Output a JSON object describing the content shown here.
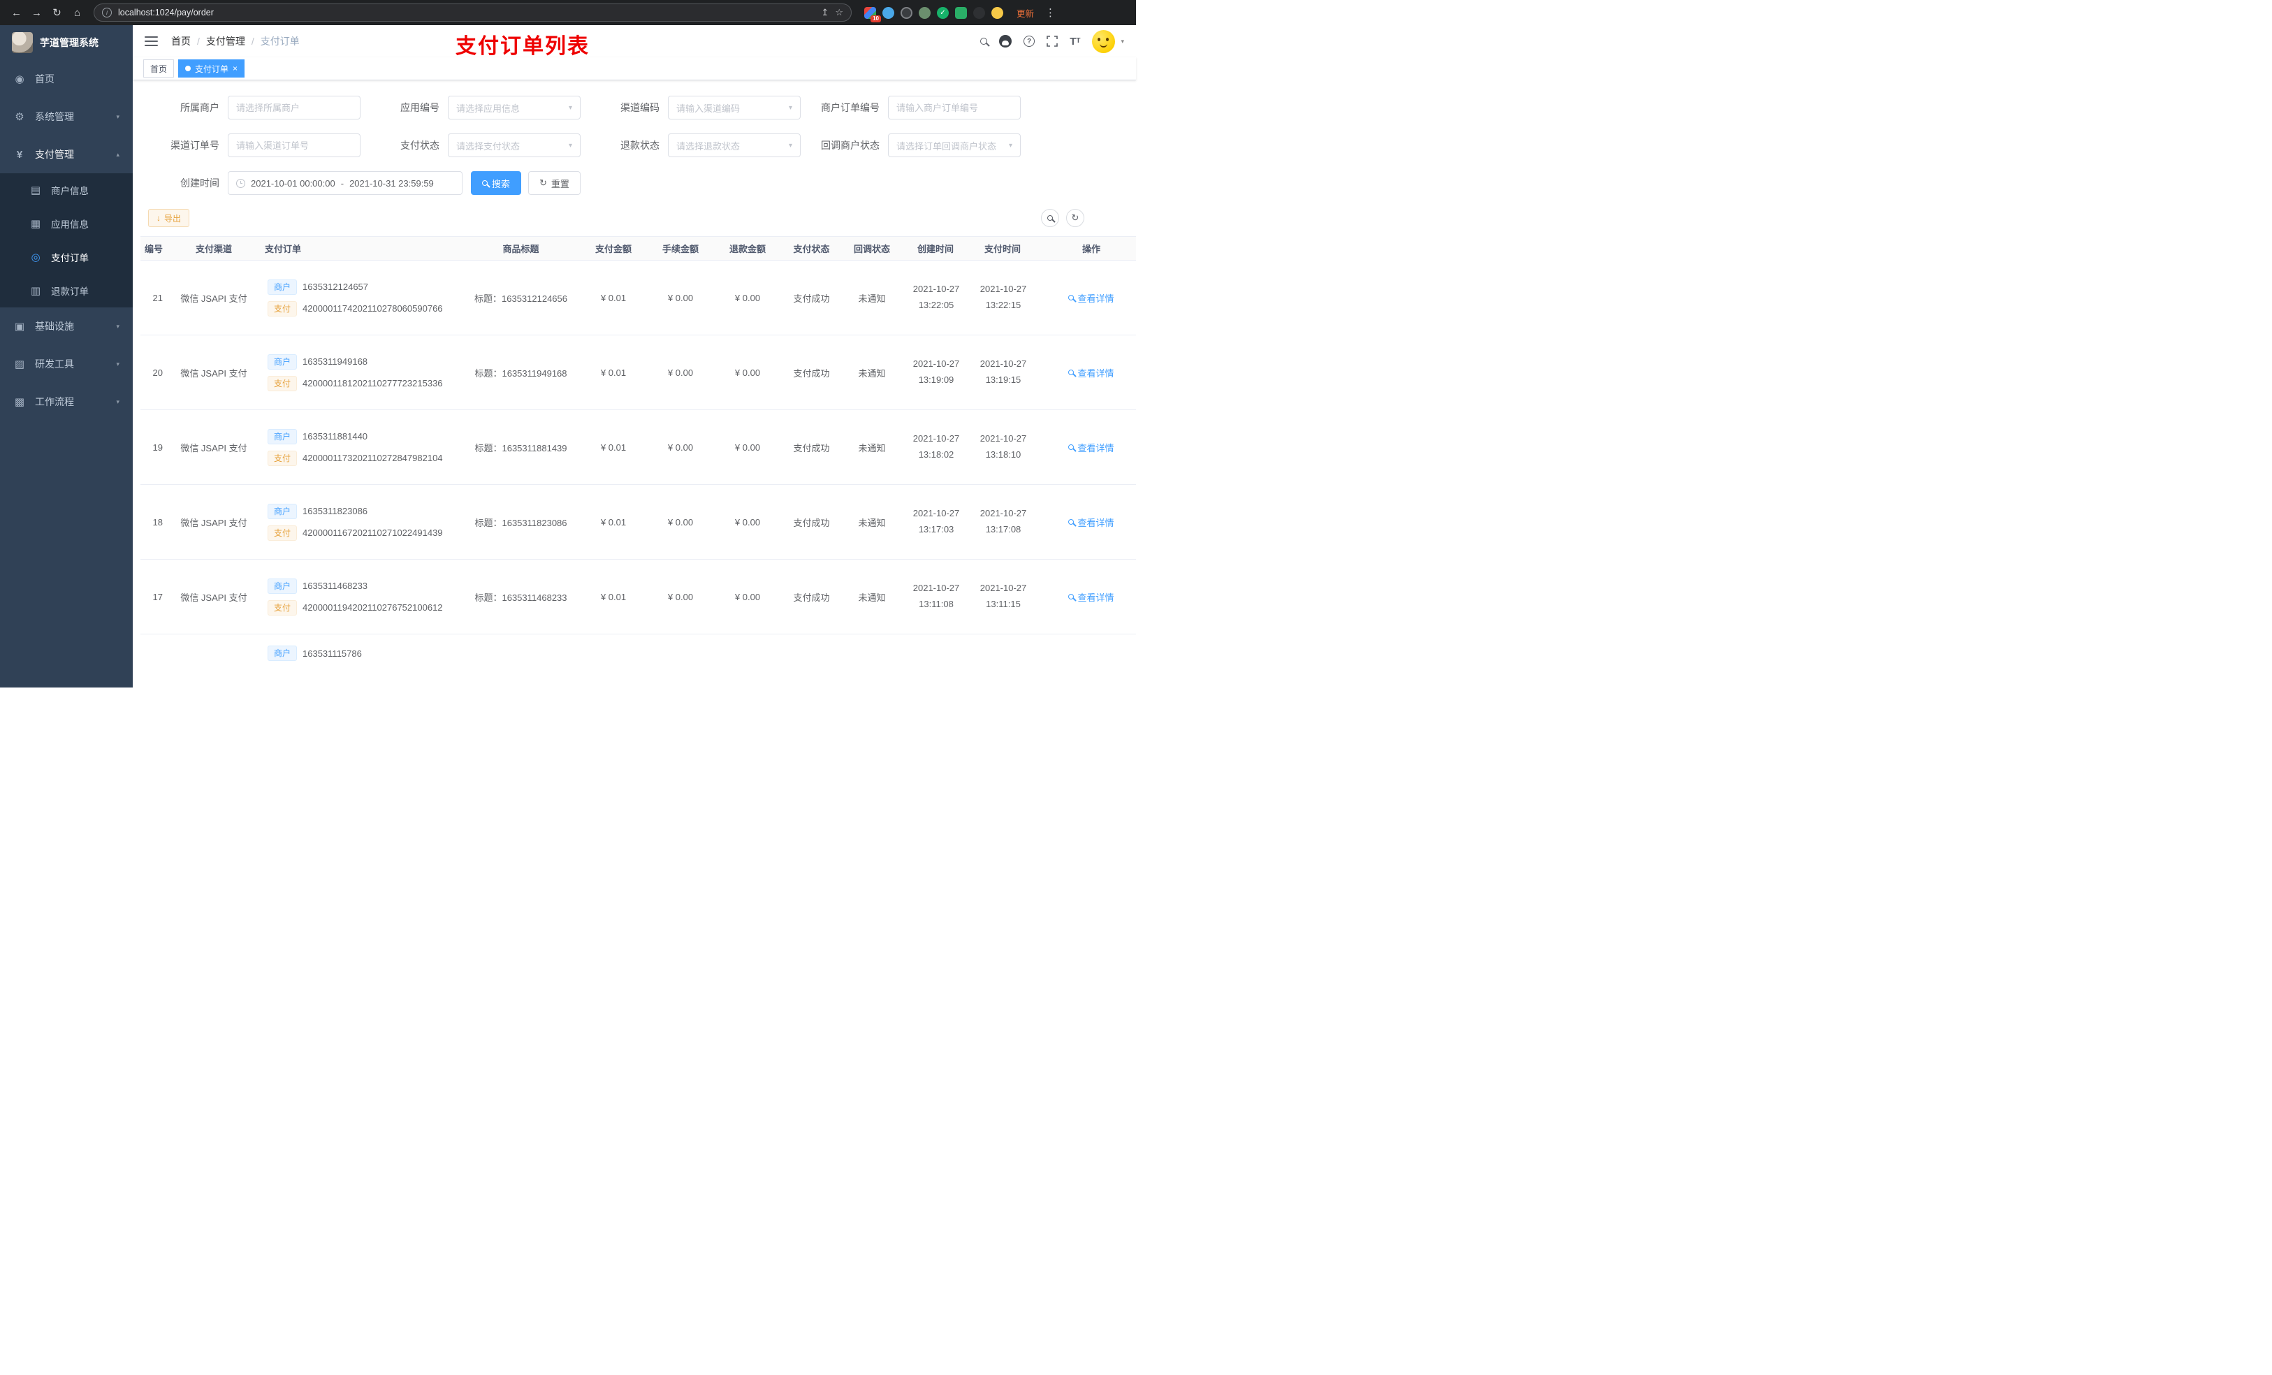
{
  "colors": {
    "accent": "#409eff",
    "warning": "#e6a23c",
    "annotation_red": "#ee0000",
    "sidebar_bg": "#304156"
  },
  "browser": {
    "url": "localhost:1024/pay/order",
    "extension_badge": "10",
    "update_label": "更新"
  },
  "sidebar": {
    "title": "芋道管理系统",
    "items": [
      {
        "label": "首页"
      },
      {
        "label": "系统管理"
      },
      {
        "label": "支付管理"
      },
      {
        "label": "商户信息"
      },
      {
        "label": "应用信息"
      },
      {
        "label": "支付订单"
      },
      {
        "label": "退款订单"
      },
      {
        "label": "基础设施"
      },
      {
        "label": "研发工具"
      },
      {
        "label": "工作流程"
      }
    ]
  },
  "header": {
    "breadcrumb": [
      "首页",
      "支付管理",
      "支付订单"
    ],
    "annotation": "支付订单列表"
  },
  "tabs": {
    "home": "首页",
    "active": "支付订单"
  },
  "filter": {
    "merchant_label": "所属商户",
    "merchant_placeholder": "请选择所属商户",
    "app_label": "应用编号",
    "app_placeholder": "请选择应用信息",
    "channel_code_label": "渠道编码",
    "channel_code_placeholder": "请输入渠道编码",
    "merchant_order_label": "商户订单编号",
    "merchant_order_placeholder": "请输入商户订单编号",
    "channel_order_label": "渠道订单号",
    "channel_order_placeholder": "请输入渠道订单号",
    "pay_status_label": "支付状态",
    "pay_status_placeholder": "请选择支付状态",
    "refund_status_label": "退款状态",
    "refund_status_placeholder": "请选择退款状态",
    "callback_status_label": "回调商户状态",
    "callback_status_placeholder": "请选择订单回调商户状态",
    "create_time_label": "创建时间",
    "date_start": "2021-10-01 00:00:00",
    "date_separator": "-",
    "date_end": "2021-10-31 23:59:59",
    "search_label": "搜索",
    "reset_label": "重置"
  },
  "toolbar": {
    "export_label": "导出"
  },
  "table": {
    "headers": [
      "编号",
      "支付渠道",
      "支付订单",
      "商品标题",
      "支付金额",
      "手续金额",
      "退款金额",
      "支付状态",
      "回调状态",
      "创建时间",
      "支付时间",
      "操作"
    ],
    "merchant_tag": "商户",
    "pay_tag": "支付",
    "detail_label": "查看详情",
    "rows": [
      {
        "id": "21",
        "channel": "微信 JSAPI 支付",
        "merchant_no": "1635312124657",
        "pay_no": "4200001174202110278060590766",
        "title": "标题：1635312124656",
        "amount": "¥ 0.01",
        "fee": "¥ 0.00",
        "refund": "¥ 0.00",
        "status": "支付成功",
        "notify": "未通知",
        "created": "2021-10-27 13:22:05",
        "paid": "2021-10-27 13:22:15"
      },
      {
        "id": "20",
        "channel": "微信 JSAPI 支付",
        "merchant_no": "1635311949168",
        "pay_no": "4200001181202110277723215336",
        "title": "标题：1635311949168",
        "amount": "¥ 0.01",
        "fee": "¥ 0.00",
        "refund": "¥ 0.00",
        "status": "支付成功",
        "notify": "未通知",
        "created": "2021-10-27 13:19:09",
        "paid": "2021-10-27 13:19:15"
      },
      {
        "id": "19",
        "channel": "微信 JSAPI 支付",
        "merchant_no": "1635311881440",
        "pay_no": "4200001173202110272847982104",
        "title": "标题：1635311881439",
        "amount": "¥ 0.01",
        "fee": "¥ 0.00",
        "refund": "¥ 0.00",
        "status": "支付成功",
        "notify": "未通知",
        "created": "2021-10-27 13:18:02",
        "paid": "2021-10-27 13:18:10"
      },
      {
        "id": "18",
        "channel": "微信 JSAPI 支付",
        "merchant_no": "1635311823086",
        "pay_no": "4200001167202110271022491439",
        "title": "标题：1635311823086",
        "amount": "¥ 0.01",
        "fee": "¥ 0.00",
        "refund": "¥ 0.00",
        "status": "支付成功",
        "notify": "未通知",
        "created": "2021-10-27 13:17:03",
        "paid": "2021-10-27 13:17:08"
      },
      {
        "id": "17",
        "channel": "微信 JSAPI 支付",
        "merchant_no": "1635311468233",
        "pay_no": "4200001194202110276752100612",
        "title": "标题：1635311468233",
        "amount": "¥ 0.01",
        "fee": "¥ 0.00",
        "refund": "¥ 0.00",
        "status": "支付成功",
        "notify": "未通知",
        "created": "2021-10-27 13:11:08",
        "paid": "2021-10-27 13:11:15"
      },
      {
        "merchant_no": "163531115786"
      }
    ]
  }
}
